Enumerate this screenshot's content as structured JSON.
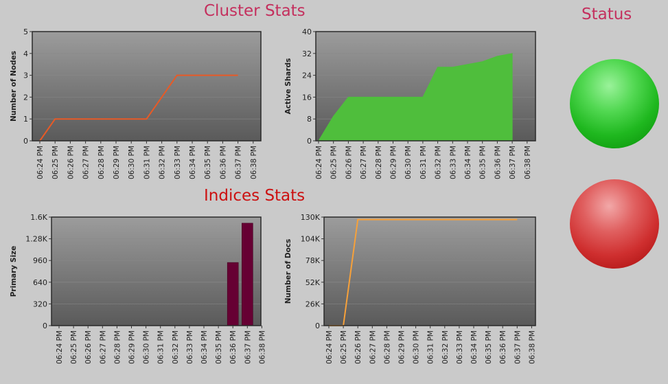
{
  "headings": {
    "cluster": "Cluster Stats",
    "indices": "Indices Stats",
    "status": "Status"
  },
  "colors": {
    "title_cluster": "#c4305e",
    "title_indices": "#cc1111",
    "nodes_line": "#e85a26",
    "shards_area": "#4fbe3c",
    "size_bars": "#660033",
    "docs_line": "#f7a13a",
    "status_green": "#22c022",
    "status_red": "#d23838"
  },
  "status": [
    {
      "name": "green-status",
      "color": "green"
    },
    {
      "name": "red-status",
      "color": "red"
    }
  ],
  "chart_data": [
    {
      "id": "nodes",
      "type": "line",
      "title": "",
      "ylabel": "Number of Nodes",
      "xlabel": "",
      "ylim": [
        0,
        5
      ],
      "yticks": [
        0,
        1,
        2,
        3,
        4,
        5
      ],
      "ytick_labels": [
        "0",
        "1",
        "2",
        "3",
        "4",
        "5"
      ],
      "categories": [
        "06:24 PM",
        "06:25 PM",
        "06:26 PM",
        "06:27 PM",
        "06:28 PM",
        "06:29 PM",
        "06:30 PM",
        "06:31 PM",
        "06:32 PM",
        "06:33 PM",
        "06:34 PM",
        "06:35 PM",
        "06:36 PM",
        "06:37 PM",
        "06:38 PM"
      ],
      "series": [
        {
          "values": [
            0,
            1,
            1,
            1,
            1,
            1,
            1,
            1,
            2,
            3,
            3,
            3,
            3,
            3,
            null
          ]
        }
      ],
      "grid": true
    },
    {
      "id": "shards",
      "type": "area",
      "title": "",
      "ylabel": "Active Shards",
      "xlabel": "",
      "ylim": [
        0,
        40
      ],
      "yticks": [
        0,
        8,
        16,
        24,
        32,
        40
      ],
      "ytick_labels": [
        "0",
        "8",
        "16",
        "24",
        "32",
        "40"
      ],
      "categories": [
        "06:24 PM",
        "06:25 PM",
        "06:26 PM",
        "06:27 PM",
        "06:28 PM",
        "06:29 PM",
        "06:30 PM",
        "06:31 PM",
        "06:32 PM",
        "06:33 PM",
        "06:34 PM",
        "06:35 PM",
        "06:36 PM",
        "06:37 PM",
        "06:38 PM"
      ],
      "series": [
        {
          "values": [
            0,
            9,
            16,
            16,
            16,
            16,
            16,
            16,
            27,
            27,
            28,
            29,
            31,
            32,
            null
          ]
        }
      ],
      "grid": true
    },
    {
      "id": "size",
      "type": "bar",
      "title": "",
      "ylabel": "Primary Size",
      "xlabel": "",
      "ylim": [
        0,
        1600
      ],
      "yticks": [
        0,
        320,
        640,
        960,
        1280,
        1600
      ],
      "ytick_labels": [
        "0",
        "320",
        "640",
        "960",
        "1.28K",
        "1.6K"
      ],
      "categories": [
        "06:24 PM",
        "06:25 PM",
        "06:26 PM",
        "06:27 PM",
        "06:28 PM",
        "06:29 PM",
        "06:30 PM",
        "06:31 PM",
        "06:32 PM",
        "06:33 PM",
        "06:34 PM",
        "06:35 PM",
        "06:36 PM",
        "06:37 PM",
        "06:38 PM"
      ],
      "series": [
        {
          "values": [
            0,
            0,
            0,
            0,
            0,
            0,
            0,
            0,
            0,
            0,
            0,
            0,
            930,
            1510,
            null
          ]
        }
      ],
      "grid": true
    },
    {
      "id": "docs",
      "type": "line",
      "title": "",
      "ylabel": "Number of Docs",
      "xlabel": "",
      "ylim": [
        0,
        130000
      ],
      "yticks": [
        0,
        26000,
        52000,
        78000,
        104000,
        130000
      ],
      "ytick_labels": [
        "0",
        "26K",
        "52K",
        "78K",
        "104K",
        "130K"
      ],
      "categories": [
        "06:24 PM",
        "06:25 PM",
        "06:26 PM",
        "06:27 PM",
        "06:28 PM",
        "06:29 PM",
        "06:30 PM",
        "06:31 PM",
        "06:32 PM",
        "06:33 PM",
        "06:34 PM",
        "06:35 PM",
        "06:36 PM",
        "06:37 PM",
        "06:38 PM"
      ],
      "series": [
        {
          "values": [
            0,
            0,
            127000,
            127000,
            127000,
            127000,
            127000,
            127000,
            127000,
            127000,
            127000,
            127000,
            127000,
            127000,
            null
          ]
        }
      ],
      "grid": true
    }
  ]
}
